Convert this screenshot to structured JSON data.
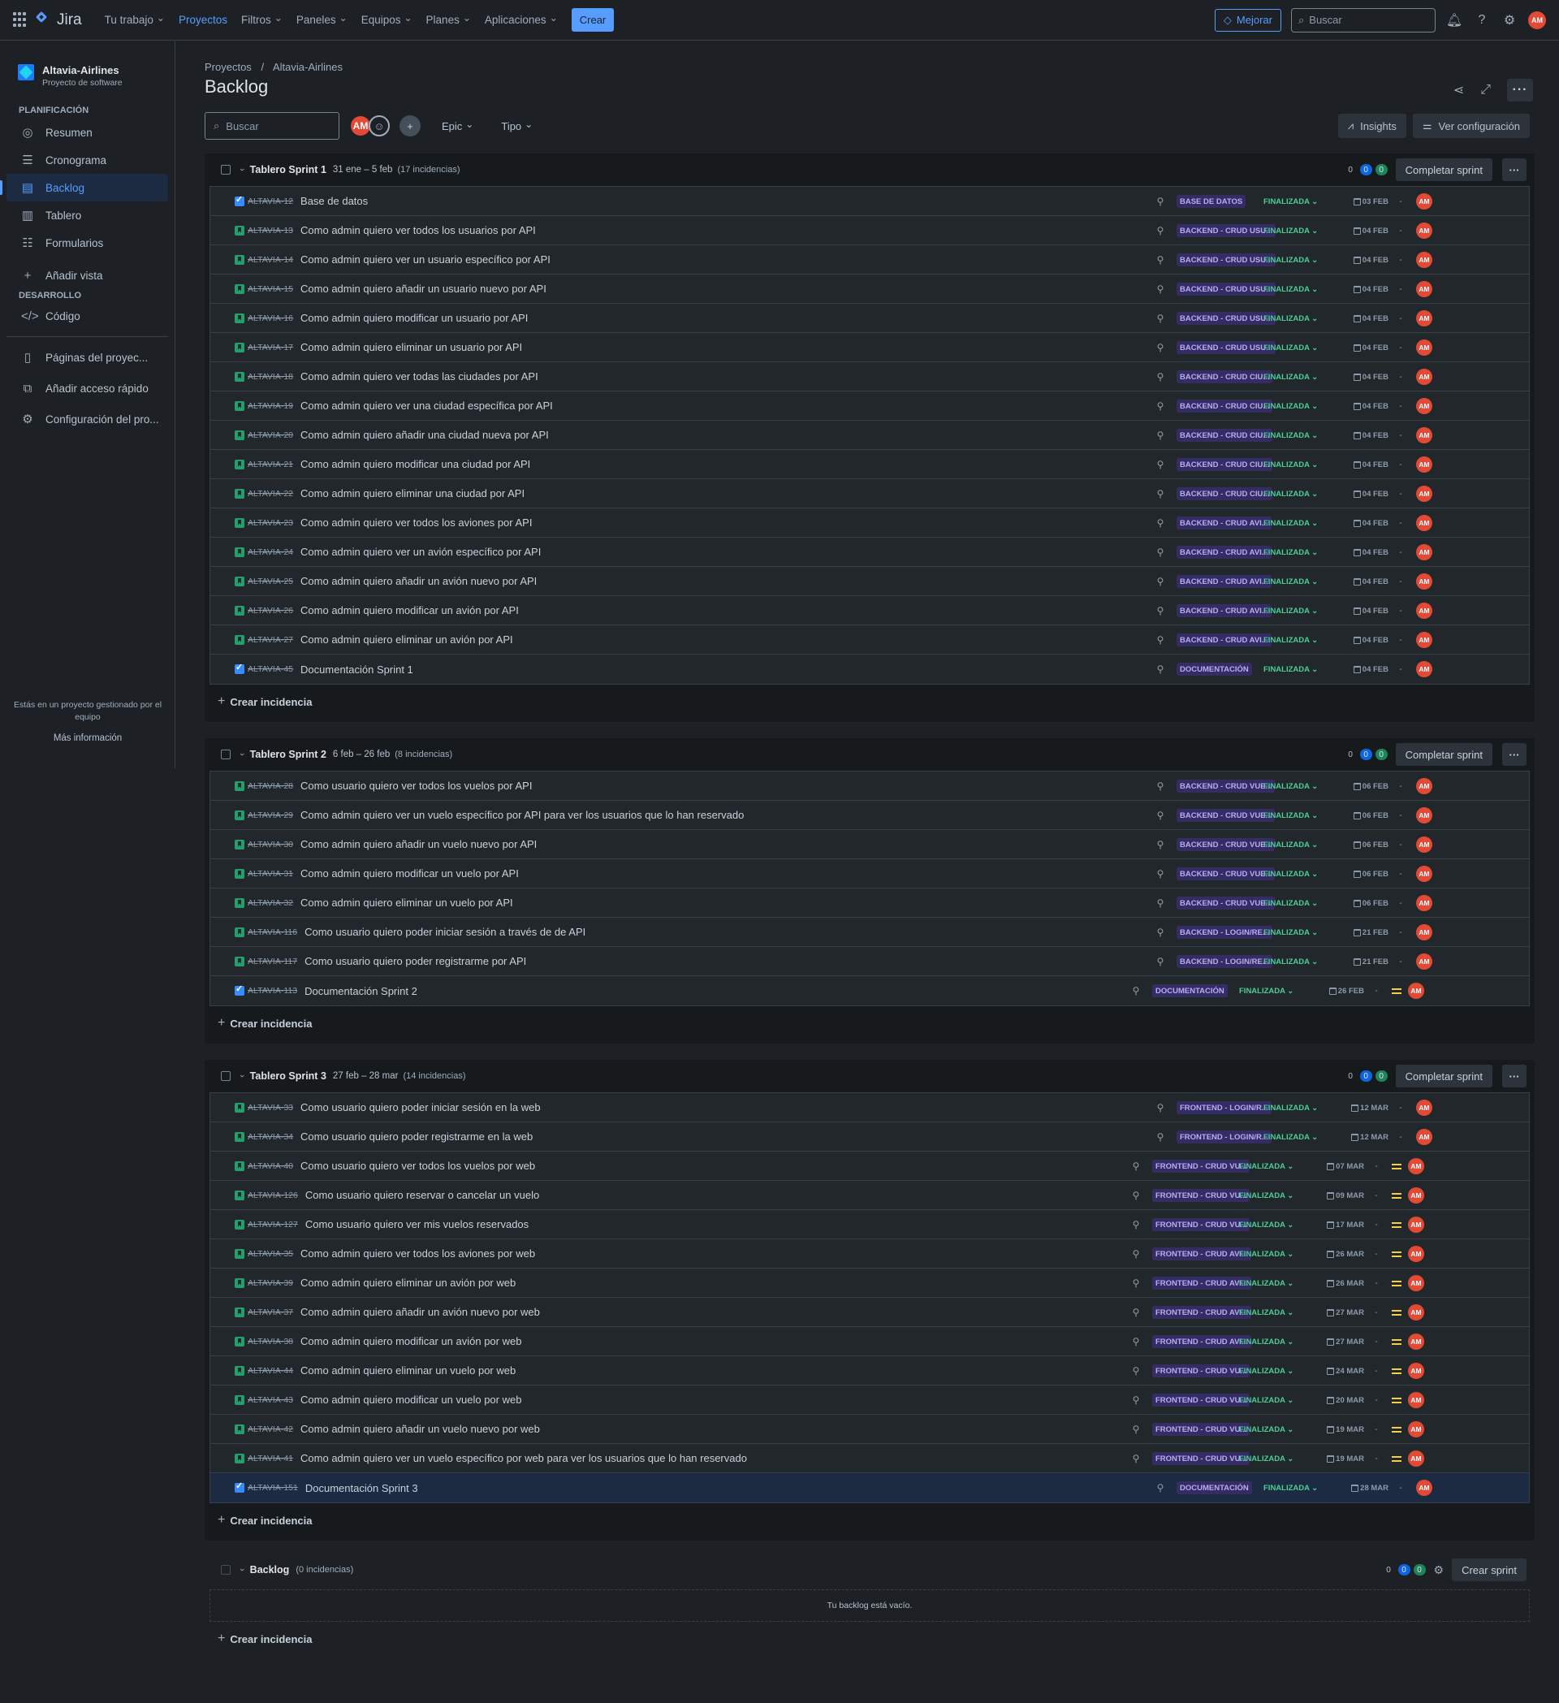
{
  "topnav": {
    "logo": "Jira",
    "items": [
      "Tu trabajo",
      "Proyectos",
      "Filtros",
      "Paneles",
      "Equipos",
      "Planes",
      "Aplicaciones"
    ],
    "create": "Crear",
    "improve": "Mejorar",
    "search_placeholder": "Buscar",
    "user_initials": "AM"
  },
  "sidebar": {
    "project_name": "Altavia-Airlines",
    "project_type": "Proyecto de software",
    "planning_heading": "PLANIFICACIÓN",
    "planning_items": [
      "Resumen",
      "Cronograma",
      "Backlog",
      "Tablero",
      "Formularios"
    ],
    "add_view": "Añadir vista",
    "dev_heading": "DESARROLLO",
    "dev_items": [
      "Código"
    ],
    "extra_items": [
      "Páginas del proyec...",
      "Añadir acceso rápido",
      "Configuración del pro..."
    ],
    "managed_note": "Estás en un proyecto gestionado por el equipo",
    "more_info": "Más información"
  },
  "page": {
    "breadcrumb_root": "Proyectos",
    "breadcrumb_sep": "/",
    "breadcrumb_project": "Altavia-Airlines",
    "title": "Backlog",
    "search_placeholder": "Buscar",
    "filter_epic": "Epic",
    "filter_type": "Tipo",
    "insights": "Insights",
    "settings": "Ver configuración",
    "create_issue": "Crear incidencia",
    "complete_sprint": "Completar sprint",
    "create_sprint": "Crear sprint",
    "status_label": "FINALIZADA",
    "assignee": "AM",
    "empty_backlog": "Tu backlog está vacío."
  },
  "sprints": [
    {
      "name": "Tablero Sprint 1",
      "dates": "31 ene – 5 feb",
      "count": "(17 incidencias)",
      "pills": [
        "0",
        "0",
        "0"
      ],
      "issues": [
        {
          "type": "task",
          "key": "ALTAVIA-12",
          "summary": "Base de datos",
          "epic": "BASE DE DATOS",
          "date": "03 FEB",
          "prio": false
        },
        {
          "type": "story",
          "key": "ALTAVIA-13",
          "summary": "Como admin quiero ver todos los usuarios por API",
          "epic": "BACKEND - CRUD USU...",
          "date": "04 FEB",
          "prio": false
        },
        {
          "type": "story",
          "key": "ALTAVIA-14",
          "summary": "Como admin quiero ver un usuario específico por API",
          "epic": "BACKEND - CRUD USU...",
          "date": "04 FEB",
          "prio": false
        },
        {
          "type": "story",
          "key": "ALTAVIA-15",
          "summary": "Como admin quiero añadir un usuario nuevo por API",
          "epic": "BACKEND - CRUD USU...",
          "date": "04 FEB",
          "prio": false
        },
        {
          "type": "story",
          "key": "ALTAVIA-16",
          "summary": "Como admin quiero modificar un usuario por API",
          "epic": "BACKEND - CRUD USU...",
          "date": "04 FEB",
          "prio": false
        },
        {
          "type": "story",
          "key": "ALTAVIA-17",
          "summary": "Como admin quiero eliminar un usuario por API",
          "epic": "BACKEND - CRUD USU...",
          "date": "04 FEB",
          "prio": false
        },
        {
          "type": "story",
          "key": "ALTAVIA-18",
          "summary": "Como admin quiero ver todas las ciudades por API",
          "epic": "BACKEND - CRUD CIU...",
          "date": "04 FEB",
          "prio": false
        },
        {
          "type": "story",
          "key": "ALTAVIA-19",
          "summary": "Como admin quiero ver una ciudad específica por API",
          "epic": "BACKEND - CRUD CIU...",
          "date": "04 FEB",
          "prio": false
        },
        {
          "type": "story",
          "key": "ALTAVIA-20",
          "summary": "Como admin quiero añadir una ciudad nueva por API",
          "epic": "BACKEND - CRUD CIU...",
          "date": "04 FEB",
          "prio": false
        },
        {
          "type": "story",
          "key": "ALTAVIA-21",
          "summary": "Como admin quiero modificar una ciudad por API",
          "epic": "BACKEND - CRUD CIU...",
          "date": "04 FEB",
          "prio": false
        },
        {
          "type": "story",
          "key": "ALTAVIA-22",
          "summary": "Como admin quiero eliminar una ciudad por API",
          "epic": "BACKEND - CRUD CIU...",
          "date": "04 FEB",
          "prio": false
        },
        {
          "type": "story",
          "key": "ALTAVIA-23",
          "summary": "Como admin quiero ver todos los aviones por API",
          "epic": "BACKEND - CRUD AVI...",
          "date": "04 FEB",
          "prio": false
        },
        {
          "type": "story",
          "key": "ALTAVIA-24",
          "summary": "Como admin quiero ver un avión específico por API",
          "epic": "BACKEND - CRUD AVI...",
          "date": "04 FEB",
          "prio": false
        },
        {
          "type": "story",
          "key": "ALTAVIA-25",
          "summary": "Como admin quiero añadir un avión nuevo por API",
          "epic": "BACKEND - CRUD AVI...",
          "date": "04 FEB",
          "prio": false
        },
        {
          "type": "story",
          "key": "ALTAVIA-26",
          "summary": "Como admin quiero modificar un avión por API",
          "epic": "BACKEND - CRUD AVI...",
          "date": "04 FEB",
          "prio": false
        },
        {
          "type": "story",
          "key": "ALTAVIA-27",
          "summary": "Como admin quiero eliminar un avión por API",
          "epic": "BACKEND - CRUD AVI...",
          "date": "04 FEB",
          "prio": false
        },
        {
          "type": "task",
          "key": "ALTAVIA-45",
          "summary": "Documentación Sprint 1",
          "epic": "DOCUMENTACIÓN",
          "date": "04 FEB",
          "prio": false
        }
      ]
    },
    {
      "name": "Tablero Sprint 2",
      "dates": "6 feb – 26 feb",
      "count": "(8 incidencias)",
      "pills": [
        "0",
        "0",
        "0"
      ],
      "issues": [
        {
          "type": "story",
          "key": "ALTAVIA-28",
          "summary": "Como usuario quiero ver todos los vuelos por API",
          "epic": "BACKEND - CRUD VUE...",
          "date": "06 FEB",
          "prio": false
        },
        {
          "type": "story",
          "key": "ALTAVIA-29",
          "summary": "Como admin quiero ver un vuelo específico por API para ver los usuarios que lo han reservado",
          "epic": "BACKEND - CRUD VUE...",
          "date": "06 FEB",
          "prio": false
        },
        {
          "type": "story",
          "key": "ALTAVIA-30",
          "summary": "Como admin quiero añadir un vuelo nuevo por API",
          "epic": "BACKEND - CRUD VUE...",
          "date": "06 FEB",
          "prio": false
        },
        {
          "type": "story",
          "key": "ALTAVIA-31",
          "summary": "Como admin quiero modificar un vuelo por API",
          "epic": "BACKEND - CRUD VUE...",
          "date": "06 FEB",
          "prio": false
        },
        {
          "type": "story",
          "key": "ALTAVIA-32",
          "summary": "Como admin quiero eliminar un vuelo por API",
          "epic": "BACKEND - CRUD VUE...",
          "date": "06 FEB",
          "prio": false
        },
        {
          "type": "story",
          "key": "ALTAVIA-116",
          "summary": "Como usuario quiero poder iniciar sesión a través de de API",
          "epic": "BACKEND - LOGIN/RE...",
          "date": "21 FEB",
          "prio": false
        },
        {
          "type": "story",
          "key": "ALTAVIA-117",
          "summary": "Como usuario quiero poder registrarme por API",
          "epic": "BACKEND - LOGIN/RE...",
          "date": "21 FEB",
          "prio": false
        },
        {
          "type": "task",
          "key": "ALTAVIA-113",
          "summary": "Documentación Sprint 2",
          "epic": "DOCUMENTACIÓN",
          "date": "26 FEB",
          "prio": true
        }
      ]
    },
    {
      "name": "Tablero Sprint 3",
      "dates": "27 feb – 28 mar",
      "count": "(14 incidencias)",
      "pills": [
        "0",
        "0",
        "0"
      ],
      "issues": [
        {
          "type": "story",
          "key": "ALTAVIA-33",
          "summary": "Como usuario quiero poder iniciar sesión en la web",
          "epic": "FRONTEND - LOGIN/R...",
          "date": "12 MAR",
          "prio": false
        },
        {
          "type": "story",
          "key": "ALTAVIA-34",
          "summary": "Como usuario quiero poder registrarme en la web",
          "epic": "FRONTEND - LOGIN/R...",
          "date": "12 MAR",
          "prio": false
        },
        {
          "type": "story",
          "key": "ALTAVIA-40",
          "summary": "Como usuario quiero ver todos los vuelos por web",
          "epic": "FRONTEND - CRUD VU...",
          "date": "07 MAR",
          "prio": true
        },
        {
          "type": "story",
          "key": "ALTAVIA-126",
          "summary": "Como usuario quiero reservar o cancelar un vuelo",
          "epic": "FRONTEND - CRUD VU...",
          "date": "09 MAR",
          "prio": true
        },
        {
          "type": "story",
          "key": "ALTAVIA-127",
          "summary": "Como usuario quiero ver mis vuelos reservados",
          "epic": "FRONTEND - CRUD VU...",
          "date": "17 MAR",
          "prio": true
        },
        {
          "type": "story",
          "key": "ALTAVIA-35",
          "summary": "Como admin quiero ver todos los aviones por web",
          "epic": "FRONTEND - CRUD AVI...",
          "date": "26 MAR",
          "prio": true
        },
        {
          "type": "story",
          "key": "ALTAVIA-39",
          "summary": "Como admin quiero eliminar un avión por web",
          "epic": "FRONTEND - CRUD AVI...",
          "date": "26 MAR",
          "prio": true
        },
        {
          "type": "story",
          "key": "ALTAVIA-37",
          "summary": "Como admin quiero añadir un avión nuevo por web",
          "epic": "FRONTEND - CRUD AVI...",
          "date": "27 MAR",
          "prio": true
        },
        {
          "type": "story",
          "key": "ALTAVIA-38",
          "summary": "Como admin quiero modificar un avión por web",
          "epic": "FRONTEND - CRUD AVI...",
          "date": "27 MAR",
          "prio": true
        },
        {
          "type": "story",
          "key": "ALTAVIA-44",
          "summary": "Como admin quiero eliminar un vuelo por web",
          "epic": "FRONTEND - CRUD VU...",
          "date": "24 MAR",
          "prio": true
        },
        {
          "type": "story",
          "key": "ALTAVIA-43",
          "summary": "Como admin quiero modificar un vuelo por web",
          "epic": "FRONTEND - CRUD VU...",
          "date": "20 MAR",
          "prio": true
        },
        {
          "type": "story",
          "key": "ALTAVIA-42",
          "summary": "Como admin quiero añadir un vuelo nuevo por web",
          "epic": "FRONTEND - CRUD VU...",
          "date": "19 MAR",
          "prio": true
        },
        {
          "type": "story",
          "key": "ALTAVIA-41",
          "summary": "Como admin quiero ver un vuelo específico por web para ver los usuarios que lo han reservado",
          "epic": "FRONTEND - CRUD VU...",
          "date": "19 MAR",
          "prio": true
        },
        {
          "type": "task",
          "key": "ALTAVIA-151",
          "summary": "Documentación Sprint 3",
          "epic": "DOCUMENTACIÓN",
          "date": "28 MAR",
          "prio": false,
          "selected": true
        }
      ]
    }
  ],
  "backlog": {
    "name": "Backlog",
    "count": "(0 incidencias)",
    "pills": [
      "0",
      "0",
      "0"
    ]
  }
}
